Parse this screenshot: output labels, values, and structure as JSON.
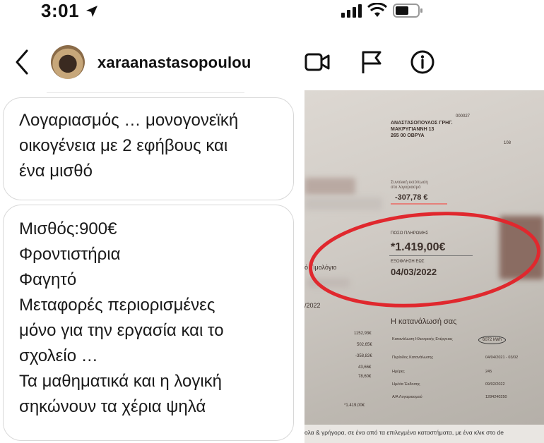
{
  "status": {
    "time": "3:01"
  },
  "header": {
    "username": "xaraanastasopoulou"
  },
  "messages": [
    {
      "lines": [
        "Λογαριασμός … μονογονεϊκή",
        "οικογένεια με 2 εφήβους και",
        "ένα μισθό"
      ]
    },
    {
      "lines": [
        "Μισθός:900€",
        "Φροντιστήρια",
        "Φαγητό",
        "Μεταφορές περιορισμένες",
        "μόνο για την εργασία και το",
        "σχολείο …",
        "Τα μαθηματικά και η λογική",
        "σηκώνουν τα χέρια ψηλά"
      ]
    }
  ],
  "bill": {
    "code": "000027",
    "name": "ΑΝΑΣΤΑΣΟΠΟΥΛΟΣ ΓΡΗΓ.",
    "street": "ΜΑΚΡΥΓΙΑΝΝΗ 13",
    "city": "265 00 ΟΒΡΥΑ",
    "page_no": "108",
    "prev_balance": "-307,78 €",
    "amount_label": "ΠΟΣΟ ΠΛΗΡΩΜΗΣ",
    "amount": "*1.419,00€",
    "due_label": "ΕΞΟΦΛΗΣΗ ΕΩΣ",
    "due_date": "04/03/2022",
    "invoice_label": "ό Τιμολόγιο",
    "date_fragment": "/2022",
    "consumption_heading": "Η κατανάλωσή σας",
    "consumption_kwh": "6072 kWh",
    "values": [
      "1152,93€",
      "502,65€",
      "-358,82€",
      "43,66€",
      "78,60€"
    ],
    "total": "*1.419,00€",
    "rows": [
      {
        "label": "Κατανάλωση Ηλεκτρικής Ενέργειας",
        "value": "6072 kWh"
      },
      {
        "label": "Περίοδος Κατανάλωσης",
        "value": "04/04/2021 - 03/02"
      },
      {
        "label": "Ημέρες",
        "value": "245"
      },
      {
        "label": "Ημ/νία Έκδοσης",
        "value": "09/02/2022"
      },
      {
        "label": "Α/Α Λογαριασμού",
        "value": "1284240250"
      }
    ],
    "footer": "ολα & γρήγορα, σε ένα από τα επιλεγμένα καταστήματα, με ένα κλικ στο de"
  },
  "colors": {
    "highlight_ring": "#e0282e",
    "bubble_border": "#d8d8d8"
  }
}
